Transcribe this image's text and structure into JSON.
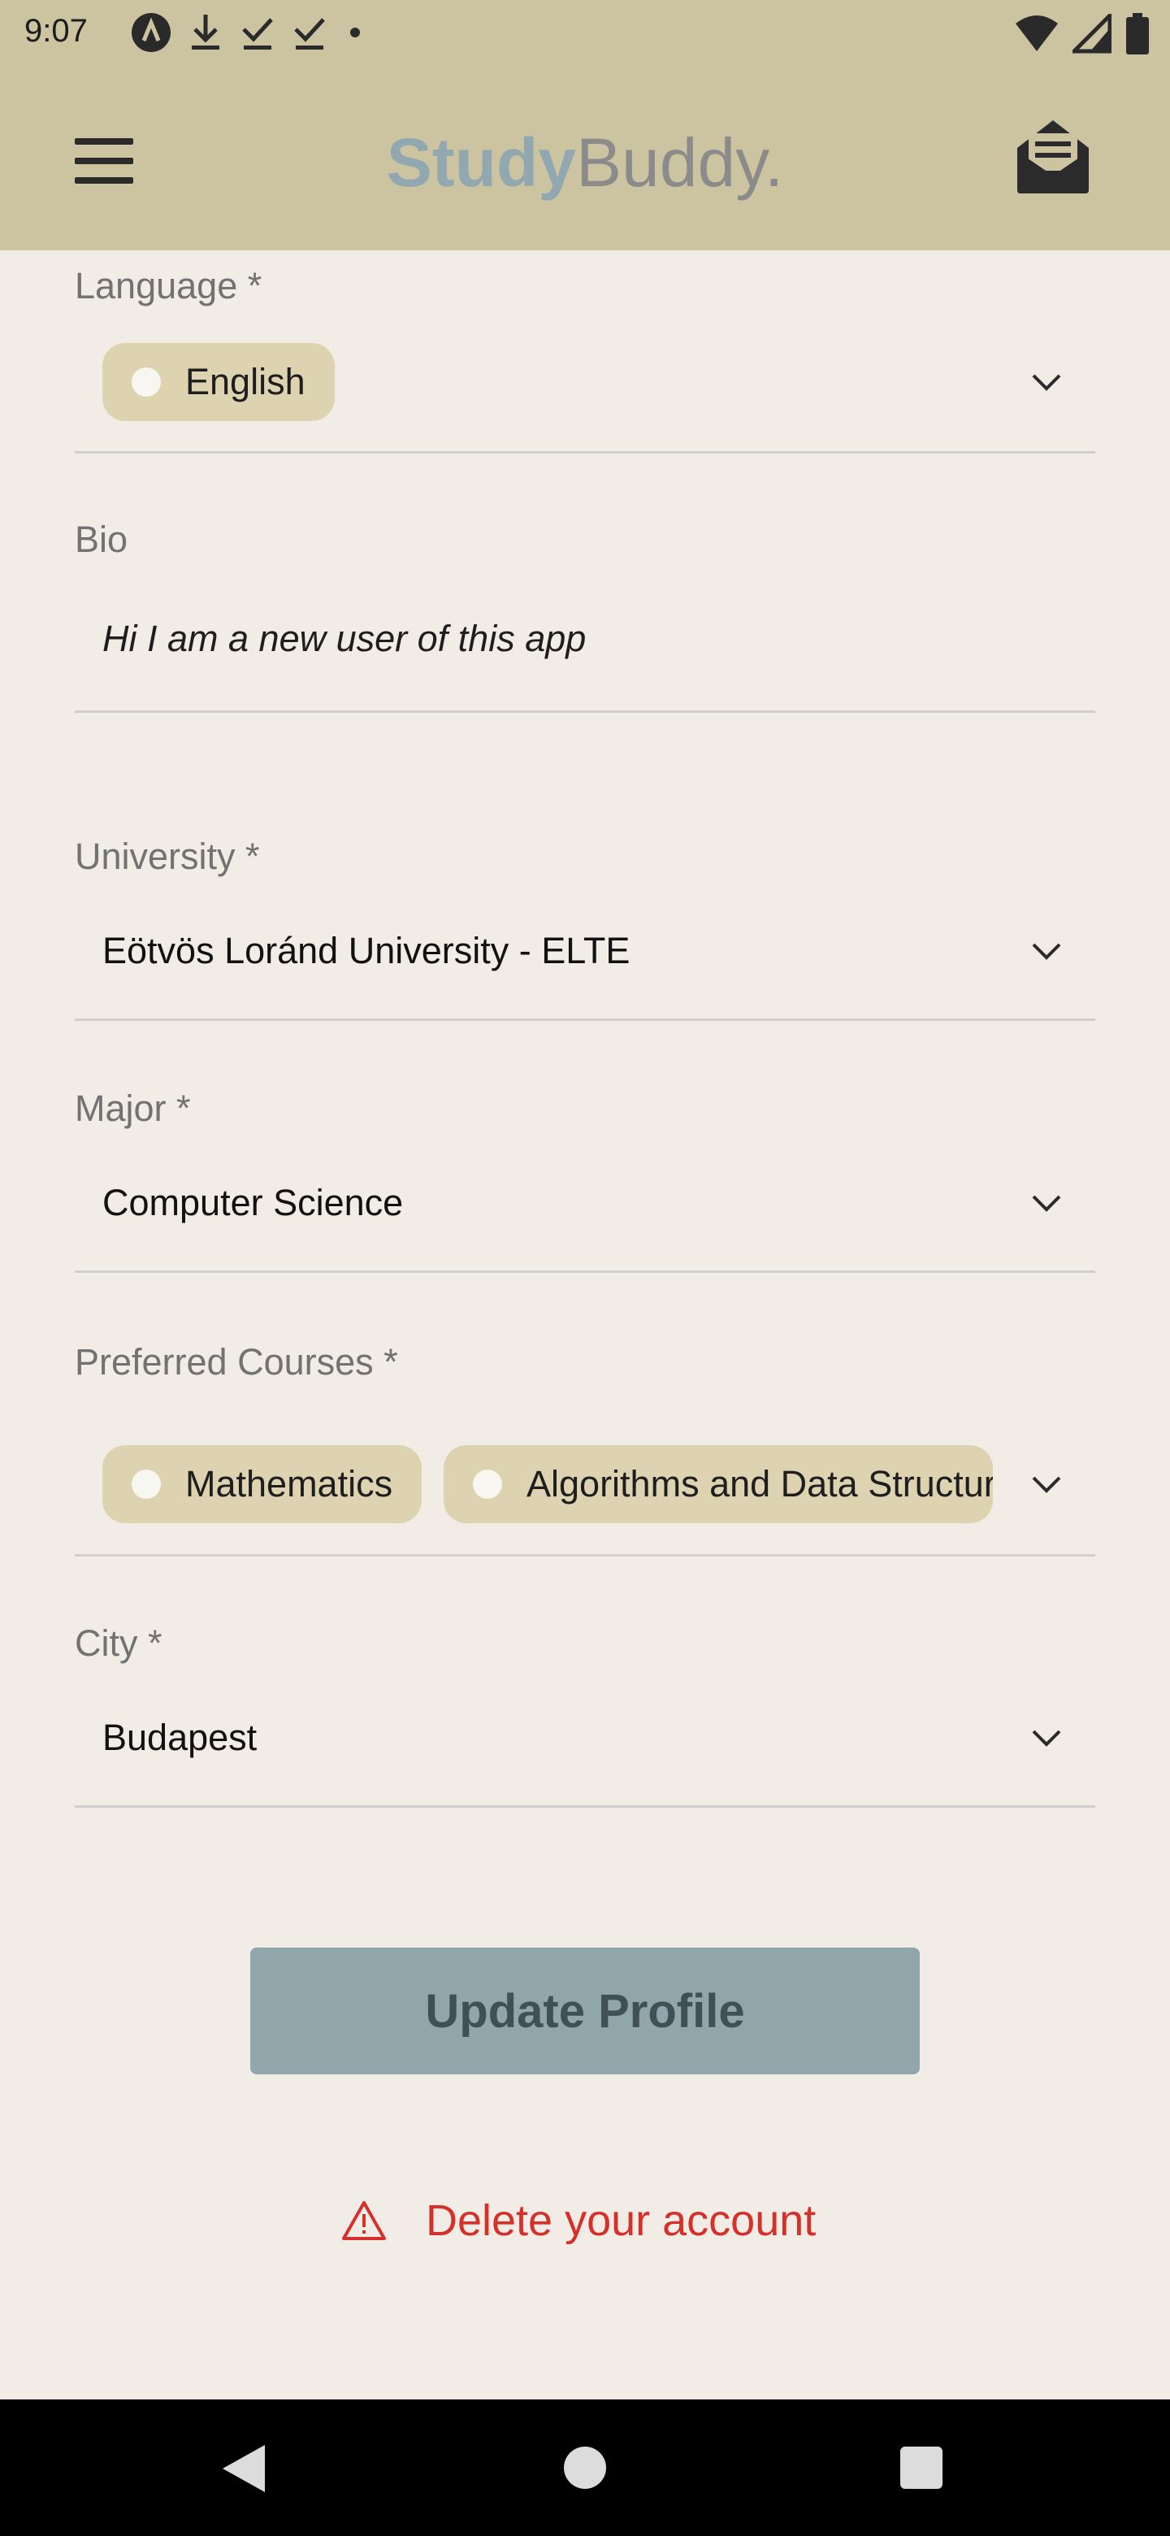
{
  "status_bar": {
    "time": "9:07",
    "left_icons": [
      "app-notification-icon",
      "download-icon",
      "download-done-icon",
      "download-done-icon",
      "dot-icon"
    ],
    "right_icons": [
      "wifi-icon",
      "signal-icon",
      "battery-icon"
    ]
  },
  "app_bar": {
    "brand_part1": "Study",
    "brand_part2": "Buddy.",
    "menu_icon": "hamburger-menu-icon",
    "mail_icon": "mail-open-icon",
    "background": "#ccc4a1"
  },
  "form": {
    "language": {
      "label": "Language *",
      "chips": [
        "English"
      ]
    },
    "bio": {
      "label": "Bio",
      "value": "Hi I am a new user of this app"
    },
    "university": {
      "label": "University *",
      "value": "Eötvös Loránd University - ELTE"
    },
    "major": {
      "label": "Major *",
      "value": "Computer Science"
    },
    "preferred_courses": {
      "label": "Preferred Courses *",
      "chips": [
        "Mathematics",
        "Algorithms and Data Structures"
      ]
    },
    "city": {
      "label": "City *",
      "value": "Budapest"
    }
  },
  "actions": {
    "update_label": "Update Profile",
    "delete_label": "Delete your account",
    "delete_color": "#d6302b",
    "update_color": "#91a6aa"
  },
  "nav_bar": {
    "icons": [
      "back-icon",
      "home-icon",
      "recents-icon"
    ]
  }
}
